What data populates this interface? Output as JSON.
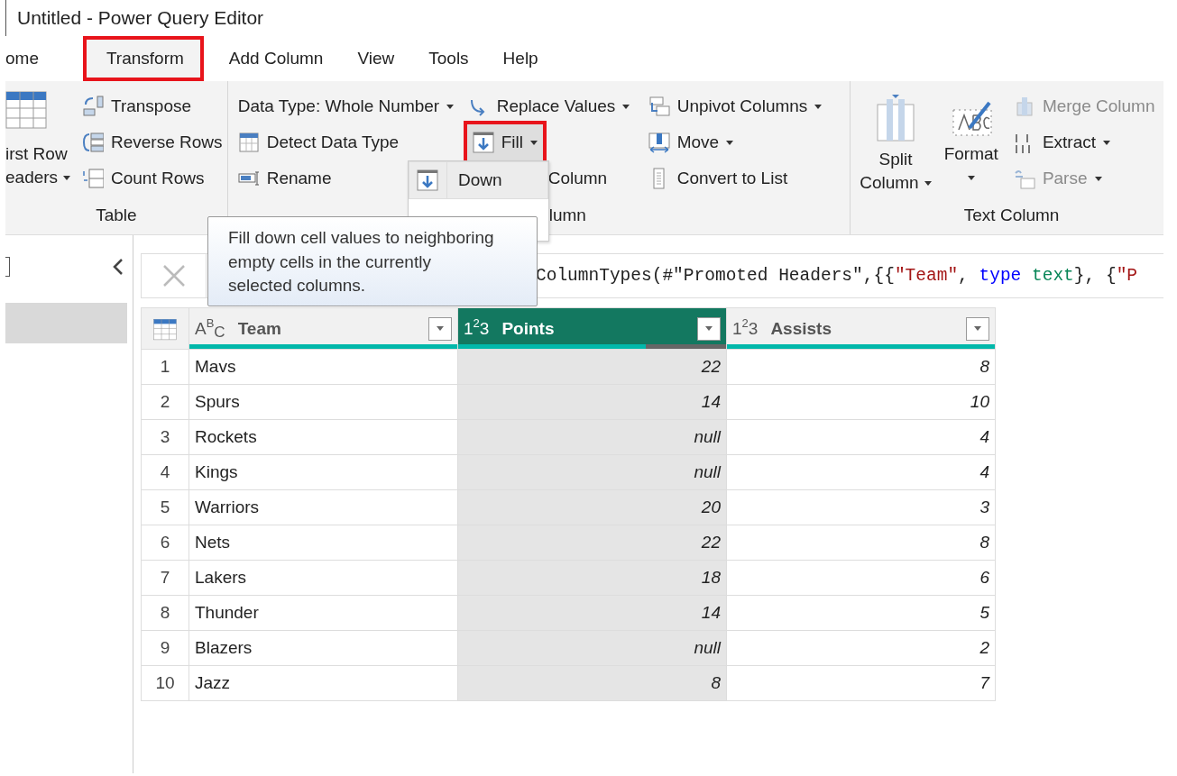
{
  "window": {
    "title": "Untitled - Power Query Editor"
  },
  "ribbon_tabs": [
    {
      "label": "ome",
      "selected": false,
      "highlighted": false
    },
    {
      "label": "Transform",
      "selected": true,
      "highlighted": true
    },
    {
      "label": "Add Column",
      "selected": false,
      "highlighted": false
    },
    {
      "label": "View",
      "selected": false,
      "highlighted": false
    },
    {
      "label": "Tools",
      "selected": false,
      "highlighted": false
    },
    {
      "label": "Help",
      "selected": false,
      "highlighted": false
    }
  ],
  "ribbon_groups": [
    {
      "label": "Table",
      "large": [
        {
          "kind": "table",
          "lines": [
            "irst Row",
            "eaders"
          ],
          "dropdown": true
        }
      ],
      "columns": [
        [
          {
            "kind": "transpose",
            "label": "Transpose",
            "dropdown": false,
            "disabled": false,
            "highlighted": false
          },
          {
            "kind": "reverse",
            "label": "Reverse Rows",
            "dropdown": false,
            "disabled": false,
            "highlighted": false
          },
          {
            "kind": "count",
            "label": "Count Rows",
            "dropdown": false,
            "disabled": false,
            "highlighted": false
          }
        ]
      ]
    },
    {
      "label": "lumn",
      "columns": [
        [
          {
            "kind": "plain",
            "label": "Data Type: Whole Number",
            "dropdown": true,
            "disabled": false,
            "highlighted": false
          },
          {
            "kind": "detect",
            "label": "Detect Data Type",
            "dropdown": false,
            "disabled": false,
            "highlighted": false
          },
          {
            "kind": "rename",
            "label": "Rename",
            "dropdown": false,
            "disabled": false,
            "highlighted": false
          }
        ],
        [
          {
            "kind": "replace",
            "label": "Replace Values",
            "dropdown": true,
            "disabled": false,
            "highlighted": false
          },
          {
            "kind": "fill",
            "label": "Fill",
            "dropdown": true,
            "disabled": false,
            "highlighted": true
          },
          {
            "kind": "covered",
            "label": "Column",
            "dropdown": false,
            "disabled": false,
            "highlighted": false
          }
        ],
        [
          {
            "kind": "unpivot",
            "label": "Unpivot Columns",
            "dropdown": true,
            "disabled": false,
            "highlighted": false
          },
          {
            "kind": "move",
            "label": "Move",
            "dropdown": true,
            "disabled": false,
            "highlighted": false
          },
          {
            "kind": "list",
            "label": "Convert to List",
            "dropdown": false,
            "disabled": false,
            "highlighted": false
          }
        ]
      ]
    },
    {
      "label": "Text Column",
      "large": [
        {
          "kind": "split",
          "lines": [
            "Split",
            "Column"
          ],
          "dropdown": true
        },
        {
          "kind": "format",
          "lines": [
            "Format"
          ],
          "dropdown": true
        }
      ],
      "columns": [
        [
          {
            "kind": "merge",
            "label": "Merge Column",
            "dropdown": false,
            "disabled": true,
            "highlighted": false
          },
          {
            "kind": "extract",
            "label": "Extract",
            "dropdown": true,
            "disabled": false,
            "highlighted": false
          },
          {
            "kind": "parse",
            "label": "Parse",
            "dropdown": true,
            "disabled": true,
            "highlighted": false
          }
        ]
      ]
    }
  ],
  "fill_menu": {
    "items": [
      {
        "label": "Down",
        "selected": true
      }
    ]
  },
  "tooltip": {
    "text": "Fill down cell values to neighboring empty cells in the currently selected columns."
  },
  "queries_pane": {
    "items": [
      {
        "selected": true
      }
    ]
  },
  "formula_bar": {
    "segments": [
      {
        "kind": "plain",
        "text": "ColumnTypes(#\"Promoted Headers\",{{"
      },
      {
        "kind": "string",
        "text": "\"Team\""
      },
      {
        "kind": "plain",
        "text": ", "
      },
      {
        "kind": "keyword",
        "text": "type"
      },
      {
        "kind": "typename",
        "text": " text"
      },
      {
        "kind": "plain",
        "text": "}, {"
      },
      {
        "kind": "string",
        "text": "\"P"
      }
    ]
  },
  "table": {
    "columns": [
      {
        "name": "Team",
        "type_label": "ABC",
        "kind": "text",
        "selected": false,
        "level": 1
      },
      {
        "name": "Points",
        "type_label": "123",
        "kind": "number",
        "selected": true,
        "level": 0.7
      },
      {
        "name": "Assists",
        "type_label": "123",
        "kind": "number",
        "selected": false,
        "level": 1
      }
    ],
    "rows": [
      {
        "index": "1",
        "cells": [
          "Mavs",
          "22",
          "8"
        ]
      },
      {
        "index": "2",
        "cells": [
          "Spurs",
          "14",
          "10"
        ]
      },
      {
        "index": "3",
        "cells": [
          "Rockets",
          "null",
          "4"
        ]
      },
      {
        "index": "4",
        "cells": [
          "Kings",
          "null",
          "4"
        ]
      },
      {
        "index": "5",
        "cells": [
          "Warriors",
          "20",
          "3"
        ]
      },
      {
        "index": "6",
        "cells": [
          "Nets",
          "22",
          "8"
        ]
      },
      {
        "index": "7",
        "cells": [
          "Lakers",
          "18",
          "6"
        ]
      },
      {
        "index": "8",
        "cells": [
          "Thunder",
          "14",
          "5"
        ]
      },
      {
        "index": "9",
        "cells": [
          "Blazers",
          "null",
          "2"
        ]
      },
      {
        "index": "10",
        "cells": [
          "Jazz",
          "8",
          "7"
        ]
      }
    ]
  }
}
